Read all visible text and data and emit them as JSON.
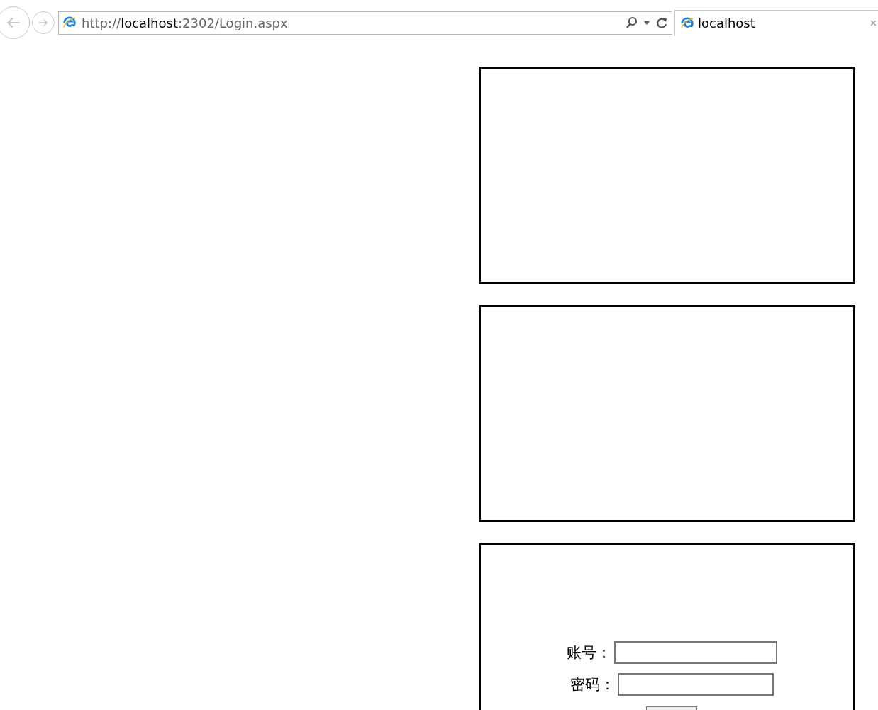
{
  "browser": {
    "address": {
      "scheme": "http://",
      "host": "localhost",
      "rest": ":2302/Login.aspx"
    },
    "tab": {
      "title": "localhost",
      "close": "×"
    }
  },
  "login_form": {
    "fields": [
      {
        "label": "账号：",
        "kind": "text"
      },
      {
        "label": "密码：",
        "kind": "password"
      }
    ]
  }
}
